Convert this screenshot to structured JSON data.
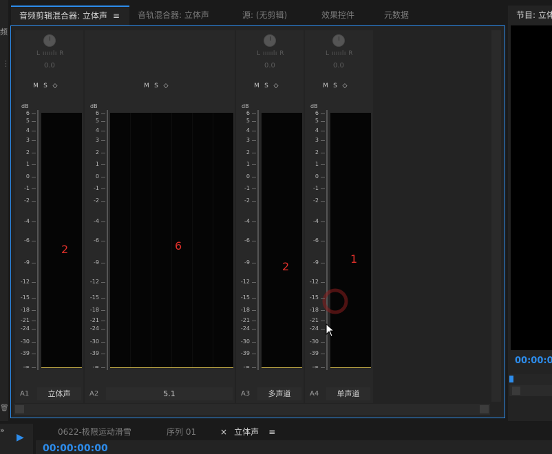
{
  "left_panel": {
    "title_fragment": "频",
    "grip": "⋮",
    "trash_icon_glyph": "🗑"
  },
  "tabs": [
    {
      "label": "音频剪辑混合器: 立体声",
      "active": true
    },
    {
      "label": "音轨混合器: 立体声",
      "active": false
    },
    {
      "label": "源: (无剪辑)",
      "active": false
    },
    {
      "label": "效果控件",
      "active": false
    },
    {
      "label": "元数据",
      "active": false
    }
  ],
  "menu_glyph": "≡",
  "strip_common": {
    "pan_lr": "L ııııılı R",
    "pan_value": "0.0",
    "mute": "M",
    "solo": "S",
    "keyframe_glyph": "◇",
    "db_label": "dB",
    "scale": [
      "6",
      "5",
      "4",
      "3",
      "2",
      "1",
      "0",
      "-1",
      "-2",
      "-4",
      "-6",
      "-9",
      "-12",
      "-15",
      "-18",
      "-21",
      "-24",
      "-30",
      "-39",
      "-∞"
    ]
  },
  "channels": [
    {
      "id": "A1",
      "name": "立体声",
      "has_pan": true,
      "annotation": "2"
    },
    {
      "id": "A2",
      "name": "5.1",
      "has_pan": false,
      "annotation": "6"
    },
    {
      "id": "A3",
      "name": "多声道",
      "has_pan": true,
      "annotation": "2"
    },
    {
      "id": "A4",
      "name": "单声道",
      "has_pan": true,
      "annotation": "1"
    }
  ],
  "program": {
    "title": "节目: 立体声",
    "timecode": "00:00:00"
  },
  "timeline": {
    "tabs": [
      {
        "label": "0622-极限运动滑雪",
        "active": false
      },
      {
        "label": "序列 01",
        "active": false
      },
      {
        "label": "立体声",
        "active": true,
        "closable": true
      }
    ],
    "close_glyph": "×",
    "timecode": "00:00:00:00",
    "tools_chevron": "»",
    "select_tool_glyph": "▶"
  },
  "colors": {
    "accent": "#2d8ceb",
    "annotation": "#e0302a",
    "meter_floor": "#c9b24a"
  }
}
